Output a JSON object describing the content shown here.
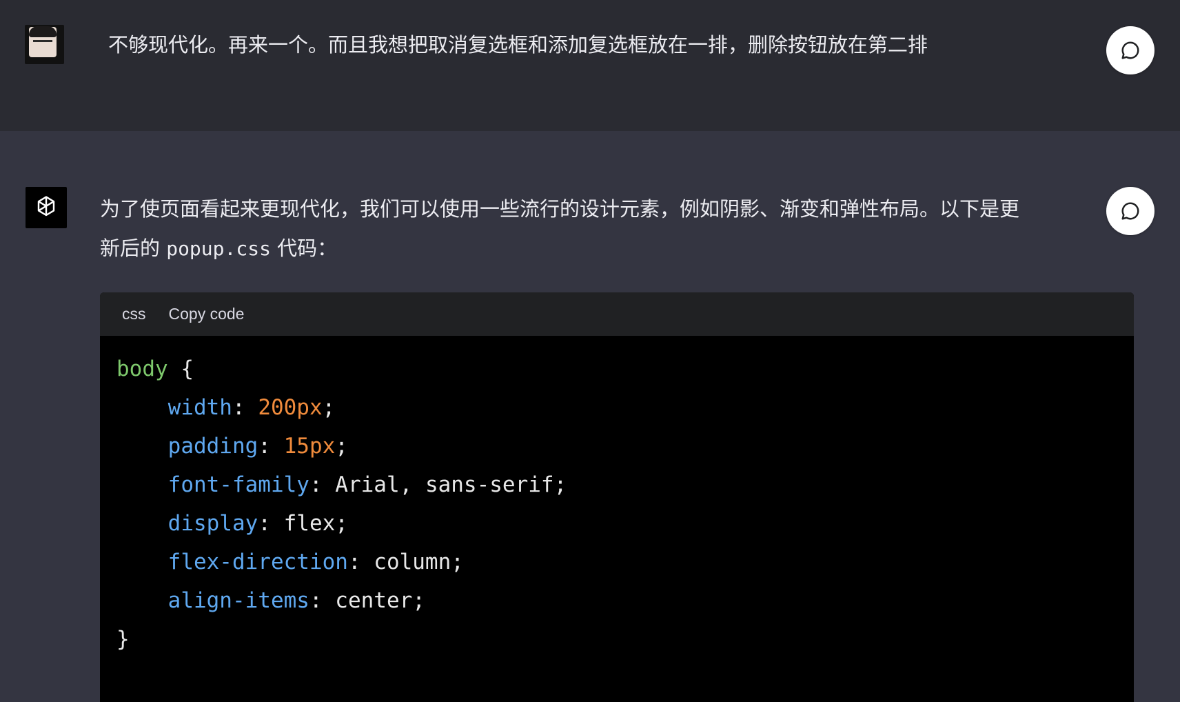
{
  "user_message": {
    "text": "不够现代化。再来一个。而且我想把取消复选框和添加复选框放在一排，删除按钮放在第二排"
  },
  "assistant_message": {
    "text_line1": "为了使页面看起来更现代化，我们可以使用一些流行的设计元素，例如阴影、渐变和弹性布局。以下是更",
    "text_line2_prefix": "新后的 ",
    "text_line2_code": "popup.css",
    "text_line2_suffix": " 代码："
  },
  "code_block": {
    "language": "css",
    "copy_label": "Copy code",
    "selector": "body",
    "open_brace": " {",
    "close_brace": "}",
    "declarations": [
      {
        "prop": "width",
        "value": "200px",
        "value_is_number": true
      },
      {
        "prop": "padding",
        "value": "15px",
        "value_is_number": true
      },
      {
        "prop": "font-family",
        "value": "Arial, sans-serif",
        "value_is_number": false
      },
      {
        "prop": "display",
        "value": "flex",
        "value_is_number": false
      },
      {
        "prop": "flex-direction",
        "value": "column",
        "value_is_number": false
      },
      {
        "prop": "align-items",
        "value": "center",
        "value_is_number": false
      }
    ]
  },
  "icons": {
    "user_avatar": "user-avatar-icon",
    "assistant_avatar": "openai-logo-icon",
    "side_button": "speech-bubble-icon",
    "copy": "clipboard-icon"
  },
  "colors": {
    "user_bg": "#2a2b32",
    "assistant_bg": "#343541",
    "code_bg": "#000000",
    "code_header_bg": "#202123",
    "selector": "#7ec86c",
    "property": "#5fa8f0",
    "number": "#f08b3c"
  }
}
